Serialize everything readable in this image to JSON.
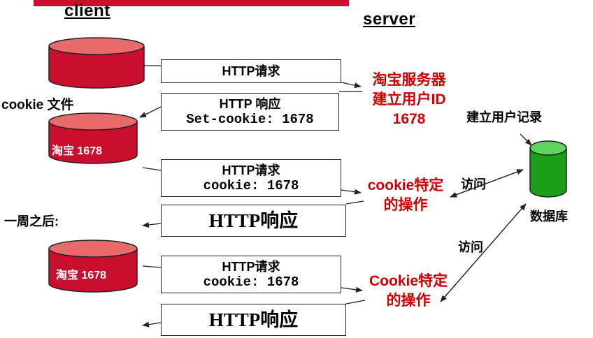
{
  "headers": {
    "client": "client",
    "server": "server"
  },
  "labels": {
    "cookie_file": "cookie 文件",
    "one_week_later": "一周之后:",
    "database": "数据库",
    "create_record": "建立用户记录",
    "access_1": "访问",
    "access_2": "访问",
    "cylinder_1": "淘宝 1678",
    "cylinder_2": "淘宝 1678"
  },
  "messages": {
    "m1": {
      "line1": "HTTP请求"
    },
    "m2": {
      "line1": "HTTP 响应",
      "line2": "Set-cookie: 1678"
    },
    "m3": {
      "line1": "HTTP请求",
      "line2": "cookie: 1678"
    },
    "m4": {
      "line1": "HTTP响应"
    },
    "m5": {
      "line1": "HTTP请求",
      "line2": "cookie: 1678"
    },
    "m6": {
      "line1": "HTTP响应"
    }
  },
  "server_notes": {
    "n1_l1": "淘宝服务器",
    "n1_l2": "建立用户ID",
    "n1_l3": "1678",
    "n2_l1": "cookie特定",
    "n2_l2": "的操作",
    "n3_l1": "Cookie特定",
    "n3_l2": "的操作"
  },
  "colors": {
    "accent_red": "#cc0000",
    "cylinder_red": "#c8102e",
    "db_green": "#1a9e1a"
  }
}
